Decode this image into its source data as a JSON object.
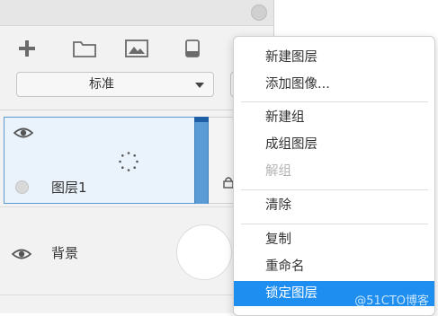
{
  "toolbar": {
    "icons": [
      "plus-icon",
      "folder-icon",
      "image-icon",
      "trash-icon"
    ]
  },
  "blend_mode": {
    "selected": "标准"
  },
  "layers": [
    {
      "name": "图层1",
      "selected": true
    },
    {
      "name": "背景",
      "selected": false
    }
  ],
  "menu": {
    "items": [
      {
        "label": "新建图层",
        "disabled": false
      },
      {
        "label": "添加图像...",
        "disabled": false
      },
      {
        "label": "新建组",
        "disabled": false
      },
      {
        "label": "成组图层",
        "disabled": false
      },
      {
        "label": "解组",
        "disabled": true
      },
      {
        "label": "清除",
        "disabled": false
      },
      {
        "label": "复制",
        "disabled": false
      },
      {
        "label": "重命名",
        "disabled": false
      },
      {
        "label": "锁定图层",
        "disabled": false,
        "highlighted": true
      }
    ]
  },
  "watermark": "@51CTO博客",
  "colors": {
    "accent": "#1e8ff0",
    "selection_border": "#5b9bd5",
    "panel_bg": "#f2f2f2"
  }
}
